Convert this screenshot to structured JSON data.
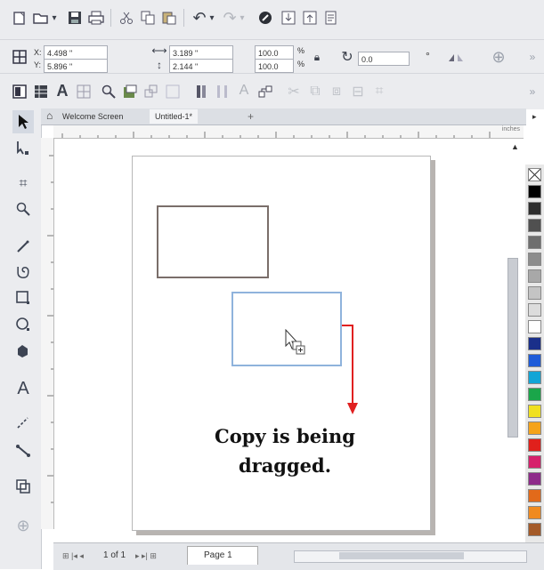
{
  "toolbar1": {
    "icons": [
      "new-doc-icon",
      "open-icon",
      "dropdown-icon",
      "save-icon",
      "print-icon",
      "cut-icon",
      "copy-icon",
      "paste-icon",
      "undo-icon",
      "redo-icon",
      "corel-connect-icon",
      "import-icon",
      "export-icon",
      "publish-pdf-icon"
    ]
  },
  "property_bar": {
    "x_label": "X:",
    "x_value": "4.498 \"",
    "y_label": "Y:",
    "y_value": "5.896 \"",
    "width_value": "3.189 \"",
    "height_value": "2.144 \"",
    "scale_w": "100.0",
    "scale_h": "100.0",
    "percent_1": "%",
    "percent_2": "%",
    "rotation_value": "0.0",
    "degree": "°"
  },
  "tabs": {
    "welcome": "Welcome Screen",
    "untitled": "Untitled-1*",
    "add": "+"
  },
  "ruler": {
    "units": "inches"
  },
  "annotation": {
    "line1": "Copy is being",
    "line2": "dragged."
  },
  "status": {
    "page_count": "1 of 1",
    "page_tab": "Page 1"
  },
  "colors": {
    "annotation_arrow": "#e02020",
    "selection": "#8fb3dc",
    "rectangle_stroke": "#7a6e6a",
    "palette": [
      "#000000",
      "#2e2e2e",
      "#505050",
      "#6e6e6e",
      "#8c8c8c",
      "#a8a8a8",
      "#c4c4c4",
      "#dcdcdc",
      "#ffffff",
      "#1a2f8a",
      "#1e5bd8",
      "#12a5d6",
      "#1aa64a",
      "#f0e020",
      "#f5a31a",
      "#e0201c",
      "#d6206c",
      "#8e2a8a",
      "#e26a1a",
      "#f08a20",
      "#a45a28"
    ]
  }
}
